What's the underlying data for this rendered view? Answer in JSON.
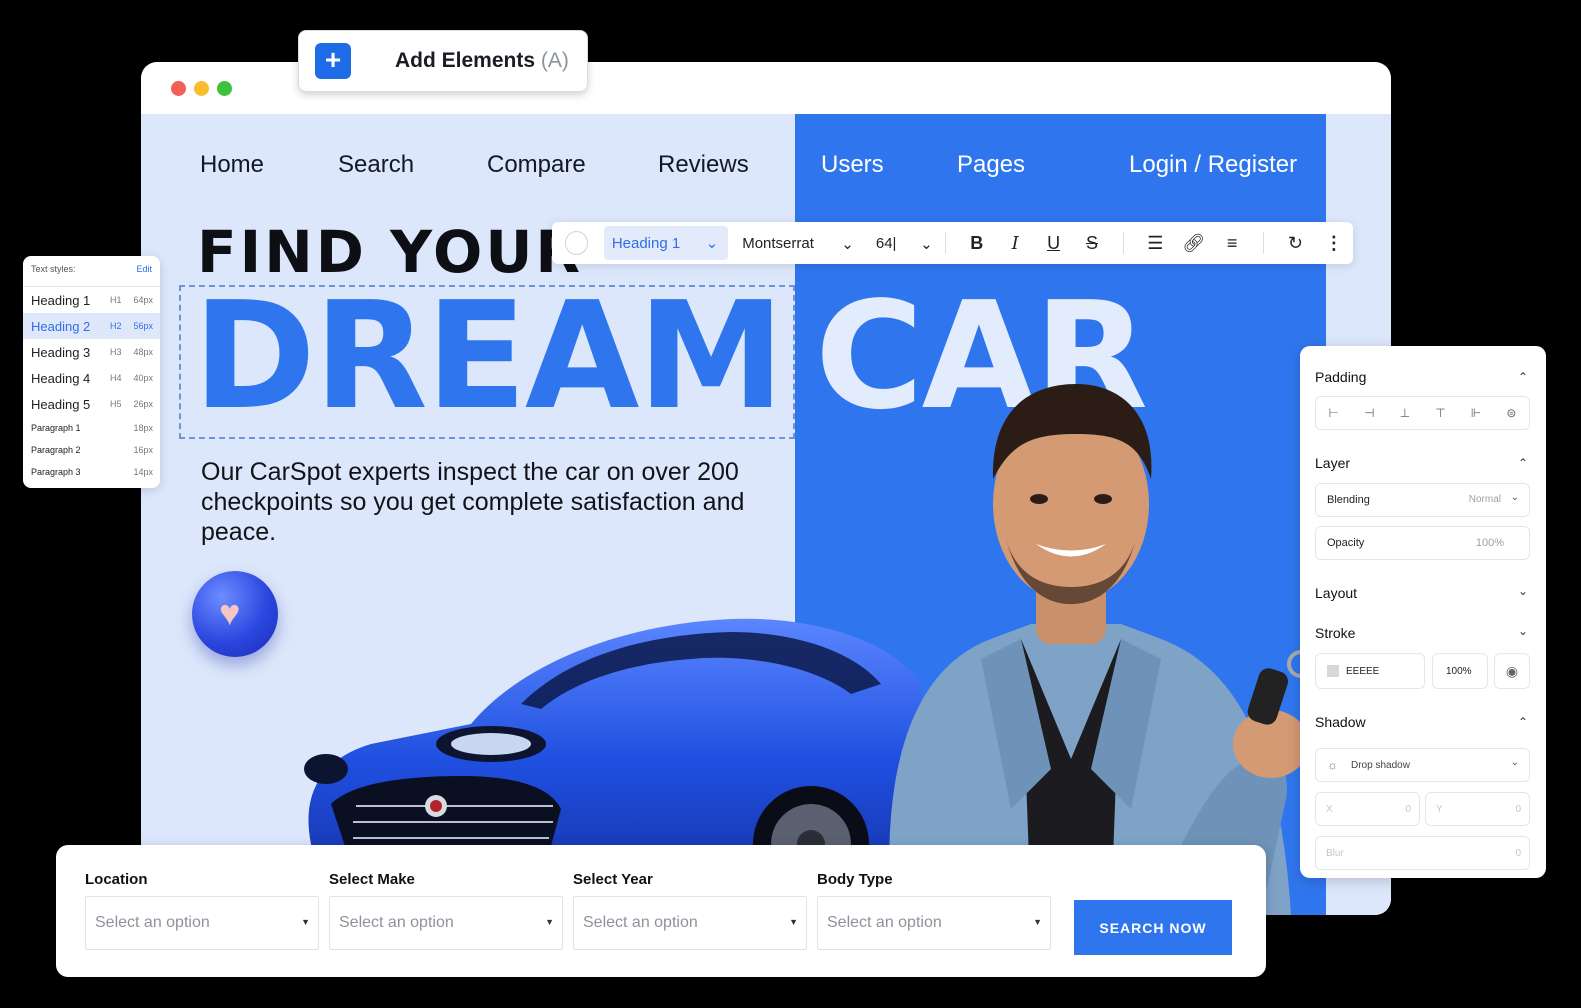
{
  "add_elements": {
    "label": "Add Elements",
    "shortcut": "(A)"
  },
  "nav": {
    "items": [
      "Home",
      "Search",
      "Compare",
      "Reviews",
      "Users",
      "Pages"
    ],
    "login": "Login / Register"
  },
  "hero": {
    "line1": "FIND YOUR",
    "word1": "DREAM",
    "word2": "CAR",
    "subtext": "Our CarSpot experts inspect the car on over 200 checkpoints so you get complete satisfaction and peace."
  },
  "toolbar": {
    "style": "Heading 1",
    "font": "Montserrat",
    "size": "64|",
    "icons": [
      "bold-icon",
      "italic-icon",
      "underline-icon",
      "strikethrough-icon",
      "list-icon",
      "link-icon",
      "align-icon",
      "rotate-icon",
      "more-icon"
    ]
  },
  "text_styles": {
    "title": "Text styles:",
    "edit": "Edit",
    "items": [
      {
        "name": "Heading 1",
        "tag": "H1",
        "size": "64px"
      },
      {
        "name": "Heading 2",
        "tag": "H2",
        "size": "56px"
      },
      {
        "name": "Heading 3",
        "tag": "H3",
        "size": "48px"
      },
      {
        "name": "Heading 4",
        "tag": "H4",
        "size": "40px"
      },
      {
        "name": "Heading 5",
        "tag": "H5",
        "size": "26px"
      },
      {
        "name": "Paragraph 1",
        "tag": "",
        "size": "18px"
      },
      {
        "name": "Paragraph 2",
        "tag": "",
        "size": "16px"
      },
      {
        "name": "Paragraph 3",
        "tag": "",
        "size": "14px"
      }
    ]
  },
  "props": {
    "padding": "Padding",
    "layer": "Layer",
    "blending_label": "Blending",
    "blending_value": "Normal",
    "opacity_label": "Opacity",
    "opacity_value": "100%",
    "layout": "Layout",
    "stroke": "Stroke",
    "stroke_color": "EEEEE",
    "stroke_opacity": "100%",
    "shadow": "Shadow",
    "shadow_type": "Drop shadow",
    "x_label": "X",
    "x_value": "0",
    "y_label": "Y",
    "y_value": "0",
    "blur_label": "Blur",
    "blur_value": "0"
  },
  "search": {
    "fields": [
      {
        "label": "Location",
        "placeholder": "Select an option"
      },
      {
        "label": "Select Make",
        "placeholder": "Select an option"
      },
      {
        "label": "Select Year",
        "placeholder": "Select an option"
      },
      {
        "label": "Body Type",
        "placeholder": "Select an option"
      }
    ],
    "button": "SEARCH NOW"
  },
  "colors": {
    "accent": "#2f76ee",
    "site_bg": "#dde7fb"
  }
}
